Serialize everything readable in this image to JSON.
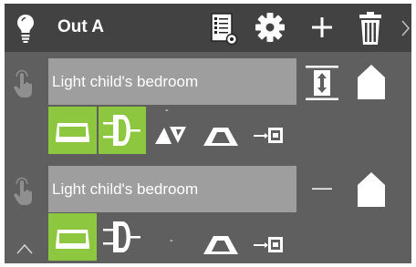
{
  "header": {
    "title": "Out A",
    "icons": [
      "bulb-icon",
      "report-icon",
      "gear-icon",
      "plus-icon",
      "trash-icon",
      "chevron-right-icon"
    ]
  },
  "rows": [
    {
      "label": "Light child's bedroom",
      "mode_symbol": "",
      "small_dash": "-"
    },
    {
      "label": "Light child's bedroom",
      "mode_symbol": "—",
      "small_dash": "-"
    }
  ],
  "footer": {
    "collapse_icon": "chevron-up-icon"
  },
  "colors": {
    "background": "#5f5f5f",
    "topbar": "#424242",
    "label_box": "#9e9e9e",
    "active_tile": "#8dc63f"
  }
}
